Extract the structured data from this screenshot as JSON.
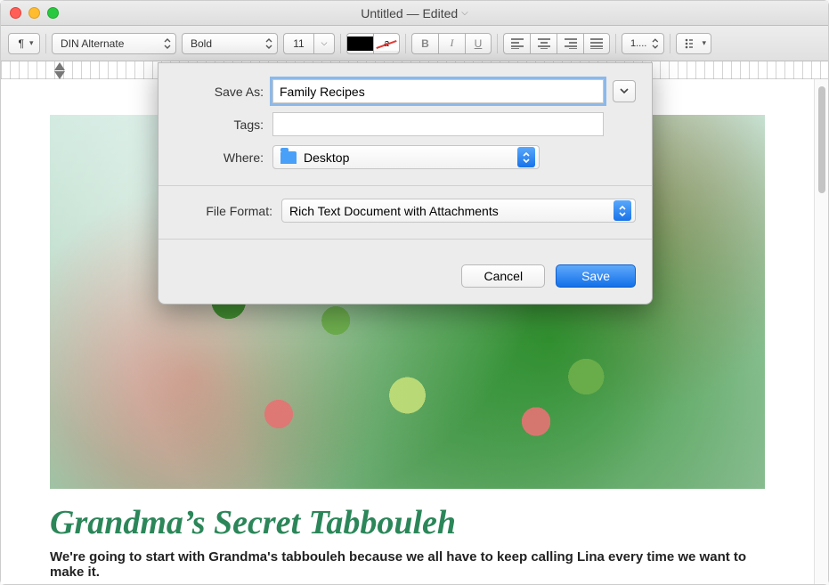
{
  "window": {
    "title": "Untitled — Edited"
  },
  "toolbar": {
    "font_family": "DIN Alternate",
    "font_weight": "Bold",
    "font_size": "11",
    "line_spacing": "1....",
    "strike_glyph": "a"
  },
  "document": {
    "heading": "Grandma’s Secret Tabbouleh",
    "body": "We're going to start with Grandma's tabbouleh because we all have to keep calling Lina every time we want to make it."
  },
  "save_sheet": {
    "labels": {
      "save_as": "Save As:",
      "tags": "Tags:",
      "where": "Where:",
      "file_format": "File Format:"
    },
    "save_as_value": "Family Recipes",
    "tags_value": "",
    "where_value": "Desktop",
    "file_format_value": "Rich Text Document with Attachments",
    "buttons": {
      "cancel": "Cancel",
      "save": "Save"
    }
  }
}
